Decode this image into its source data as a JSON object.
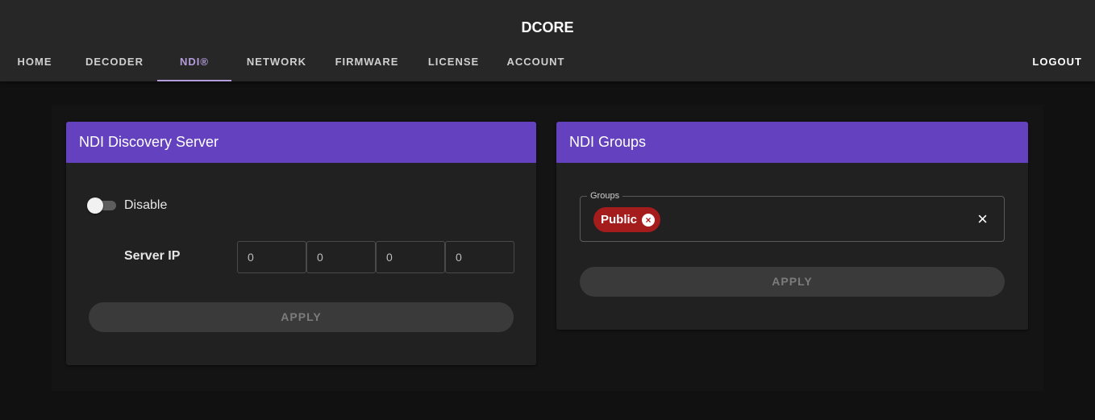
{
  "app": {
    "title": "DCORE"
  },
  "nav": {
    "tabs": [
      {
        "label": "HOME"
      },
      {
        "label": "DECODER"
      },
      {
        "label": "NDI®"
      },
      {
        "label": "NETWORK"
      },
      {
        "label": "FIRMWARE"
      },
      {
        "label": "LICENSE"
      },
      {
        "label": "ACCOUNT"
      }
    ],
    "active_tab": "NDI®",
    "logout_label": "LOGOUT"
  },
  "discovery": {
    "title": "NDI Discovery Server",
    "toggle_label": "Disable",
    "toggle_on": false,
    "server_ip_label": "Server IP",
    "ip": [
      "0",
      "0",
      "0",
      "0"
    ],
    "apply_label": "APPLY"
  },
  "groups": {
    "title": "NDI Groups",
    "field_label": "Groups",
    "chips": [
      {
        "label": "Public"
      }
    ],
    "clear_icon": "×",
    "apply_label": "APPLY"
  },
  "colors": {
    "accent": "#6442bf",
    "active_tab": "#b39ddb",
    "chip": "#a51c1c"
  }
}
